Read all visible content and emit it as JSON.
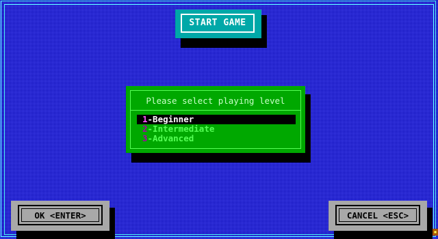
{
  "header": {
    "start_label": "START GAME"
  },
  "level_dialog": {
    "title": "Please select playing level",
    "options": [
      {
        "num": "1",
        "label": "-Beginner",
        "selected": true
      },
      {
        "num": "2",
        "label": "-Intermediate",
        "selected": false
      },
      {
        "num": "3",
        "label": "-Advanced",
        "selected": false
      }
    ]
  },
  "buttons": {
    "ok_label": "OK <ENTER>",
    "cancel_label": "CANCEL <ESC>"
  },
  "colors": {
    "background": "#0000a8",
    "dialog": "#00a800",
    "start_box": "#00a8a8",
    "button": "#a8a8a8",
    "selected_row": "#000000"
  }
}
